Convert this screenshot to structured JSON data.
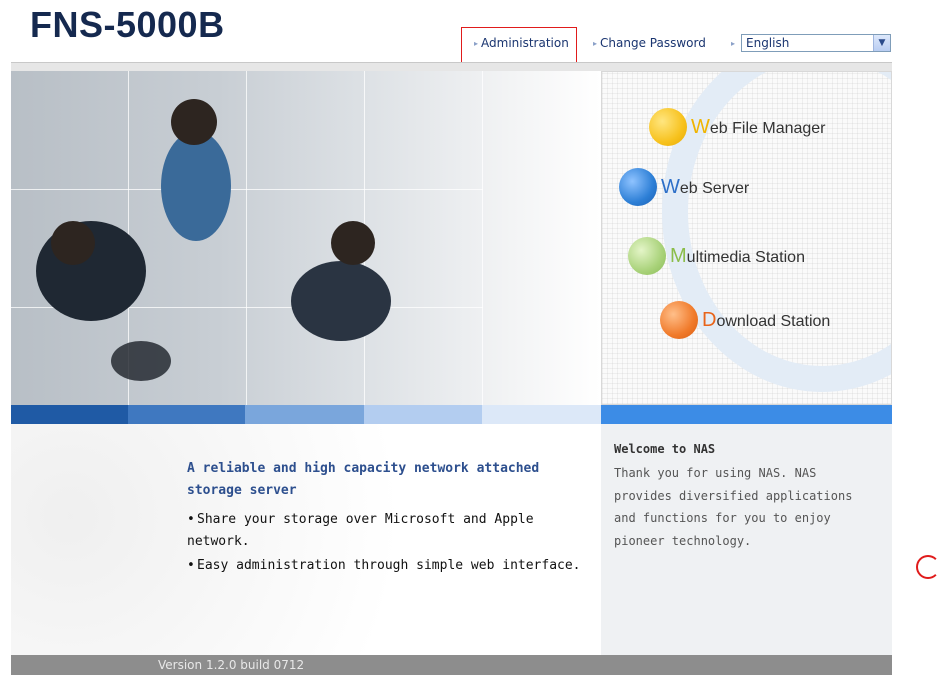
{
  "header": {
    "logo": "FNS-5000B",
    "nav": {
      "administration": "Administration",
      "change_password": "Change Password"
    },
    "language": {
      "selected": "English"
    }
  },
  "apps": [
    {
      "first": "W",
      "rest": "eb File Manager",
      "color": "#f7c21e"
    },
    {
      "first": "W",
      "rest": "eb Server",
      "color": "#2d7fd6"
    },
    {
      "first": "M",
      "rest": "ultimedia Station",
      "color": "#a9d27a"
    },
    {
      "first": "D",
      "rest": "ownload Station",
      "color": "#f07a2a"
    }
  ],
  "main": {
    "headline": "A reliable and high capacity network attached storage server",
    "bullets": [
      "Share your storage over Microsoft and Apple network.",
      "Easy administration through simple web interface."
    ]
  },
  "welcome": {
    "title": "Welcome to NAS",
    "text": "Thank you for using NAS. NAS provides diversified applications and functions for you to enjoy pioneer technology."
  },
  "footer": {
    "version": "Version 1.2.0 build 0712"
  },
  "colors": {
    "logo": "#15294f",
    "link": "#1a3570",
    "highlight": "#e01b1b",
    "headline": "#2d4f8e",
    "bar_dark": "#1f5aa5",
    "bar_accent": "#3c8ce6",
    "footer": "#8d8d8d"
  }
}
